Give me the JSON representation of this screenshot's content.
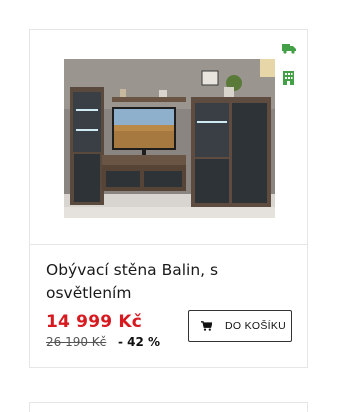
{
  "product": {
    "name": "Obývací stěna Balin, s osvětlením",
    "price": "14 999 Kč",
    "old_price": "26 190 Kč",
    "discount": "- 42 %",
    "image": "living-room-wall-unit-photo"
  },
  "badges": {
    "delivery_icon": "truck-icon",
    "store_icon": "store-building-icon",
    "color": "#43a047"
  },
  "cart_button": {
    "label": "DO KOŠÍKU",
    "icon": "shopping-cart-icon"
  },
  "colors": {
    "price": "#d71920",
    "border": "#e6e6e6"
  }
}
